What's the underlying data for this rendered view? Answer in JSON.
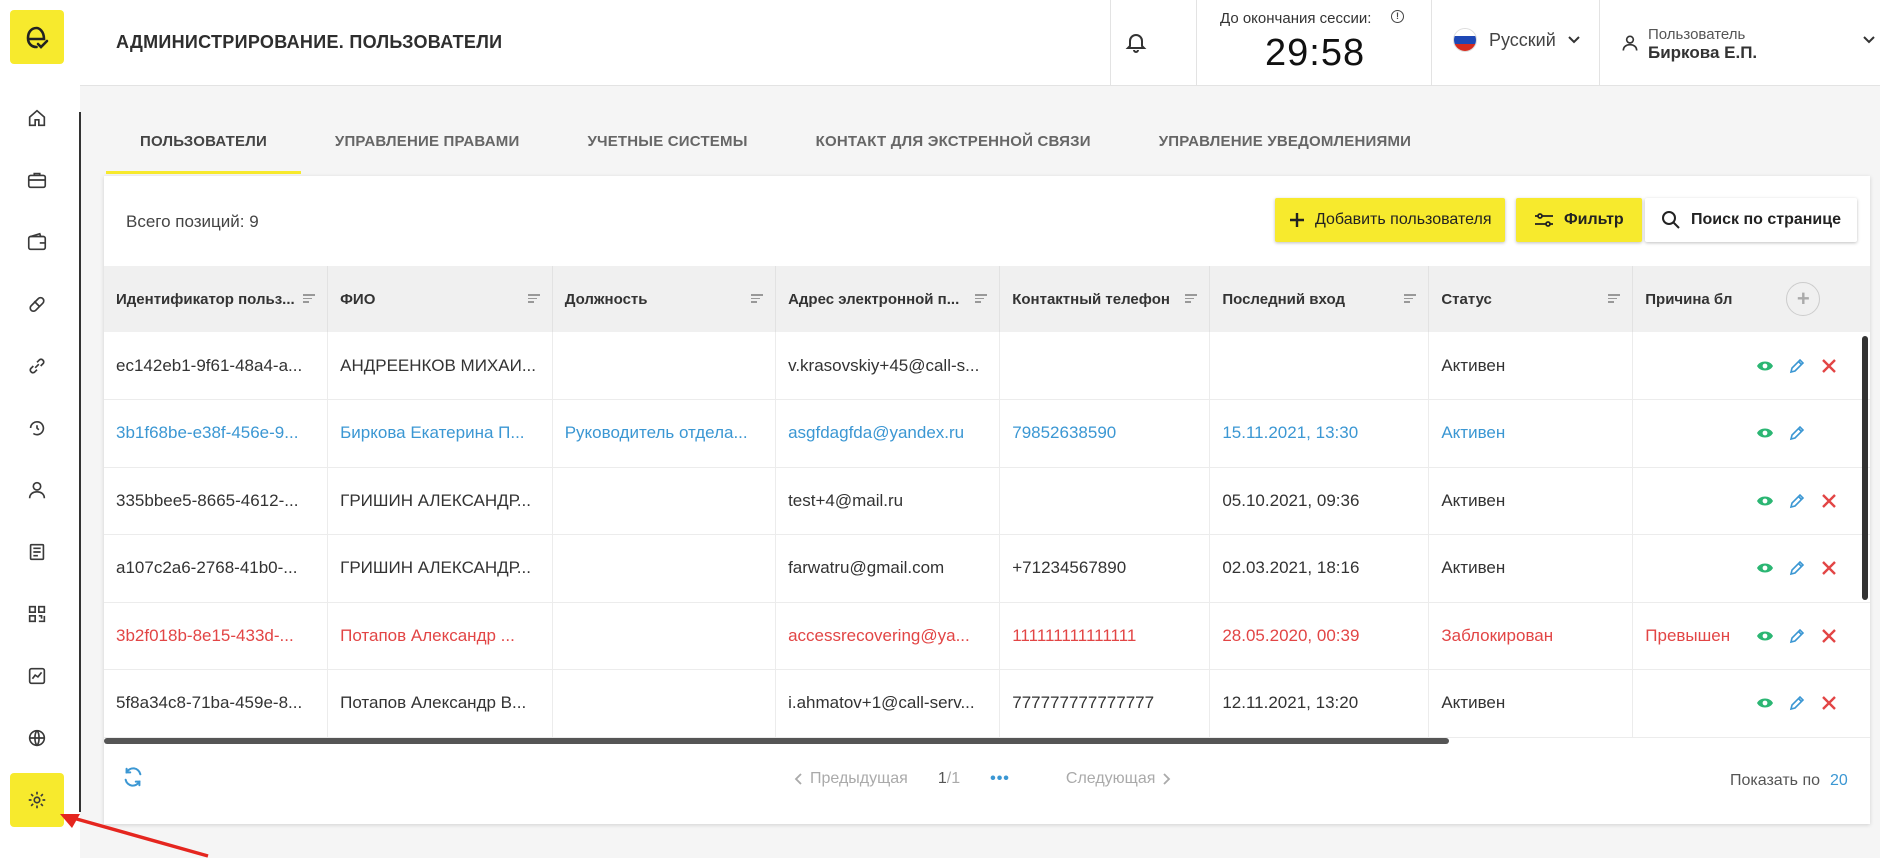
{
  "header": {
    "title": "АДМИНИСТРИРОВАНИЕ. ПОЛЬЗОВАТЕЛИ",
    "session_label": "До окончания сессии:",
    "session_time": "29:58",
    "language": "Русский",
    "user_caption": "Пользователь",
    "user_name": "Биркова Е.П."
  },
  "sidebar": {
    "items": [
      {
        "icon": "home-icon"
      },
      {
        "icon": "briefcase-icon"
      },
      {
        "icon": "wallet-icon"
      },
      {
        "icon": "pill-icon"
      },
      {
        "icon": "link-icon"
      },
      {
        "icon": "history-icon"
      },
      {
        "icon": "user-icon"
      },
      {
        "icon": "document-list-icon"
      },
      {
        "icon": "qr-code-icon"
      },
      {
        "icon": "chart-icon"
      },
      {
        "icon": "globe-icon"
      },
      {
        "icon": "gear-icon",
        "active": true
      }
    ]
  },
  "tabs": [
    {
      "label": "ПОЛЬЗОВАТЕЛИ",
      "active": true
    },
    {
      "label": "УПРАВЛЕНИЕ ПРАВАМИ"
    },
    {
      "label": "УЧЕТНЫЕ СИСТЕМЫ"
    },
    {
      "label": "КОНТАКТ ДЛЯ ЭКСТРЕННОЙ СВЯЗИ"
    },
    {
      "label": "УПРАВЛЕНИЕ УВЕДОМЛЕНИЯМИ"
    }
  ],
  "toolbar": {
    "total": "Всего позиций: 9",
    "add_user": "Добавить пользователя",
    "filter": "Фильтр",
    "search": "Поиск по странице"
  },
  "table": {
    "columns": [
      "Идентификатор польз...",
      "ФИО",
      "Должность",
      "Адрес электронной п...",
      "Контактный телефон",
      "Последний вход",
      "Статус",
      "Причина бл"
    ],
    "rows": [
      {
        "style": "normal",
        "cells": [
          "ec142eb1-9f61-48a4-a...",
          "АНДРЕЕНКОВ МИХАИ...",
          "",
          "v.krasovskiy+45@call-s...",
          "",
          "",
          "Активен",
          ""
        ],
        "delete": true
      },
      {
        "style": "blue",
        "cells": [
          "3b1f68be-e38f-456e-9...",
          "Биркова Екатерина П...",
          "Руководитель отдела...",
          "asgfdagfda@yandex.ru",
          "79852638590",
          "15.11.2021, 13:30",
          "Активен",
          ""
        ],
        "delete": false
      },
      {
        "style": "normal",
        "cells": [
          "335bbee5-8665-4612-...",
          "ГРИШИН АЛЕКСАНДР...",
          "",
          "test+4@mail.ru",
          "",
          "05.10.2021, 09:36",
          "Активен",
          ""
        ],
        "delete": true
      },
      {
        "style": "normal",
        "cells": [
          "a107c2a6-2768-41b0-...",
          "ГРИШИН АЛЕКСАНДР...",
          "",
          "farwatru@gmail.com",
          "+71234567890",
          "02.03.2021, 18:16",
          "Активен",
          ""
        ],
        "delete": true
      },
      {
        "style": "red",
        "cells": [
          "3b2f018b-8e15-433d-...",
          "Потапов Александр ...",
          "",
          "accessrecovering@ya...",
          "111111111111111",
          "28.05.2020, 00:39",
          "Заблокирован",
          "Превышен"
        ],
        "delete": true
      },
      {
        "style": "normal",
        "cells": [
          "5f8a34c8-71ba-459e-8...",
          "Потапов Александр В...",
          "",
          "i.ahmatov+1@call-serv...",
          "777777777777777",
          "12.11.2021, 13:20",
          "Активен",
          ""
        ],
        "delete": true
      }
    ]
  },
  "pager": {
    "prev": "Предыдущая",
    "current": "1",
    "total": "/1",
    "dots": "•••",
    "next": "Следующая",
    "per_page_label": "Показать по",
    "per_page_value": "20"
  },
  "colors": {
    "accent": "#f7ea2d",
    "link": "#3b97d3",
    "danger": "#e24545",
    "view_icon": "#2bb673"
  }
}
